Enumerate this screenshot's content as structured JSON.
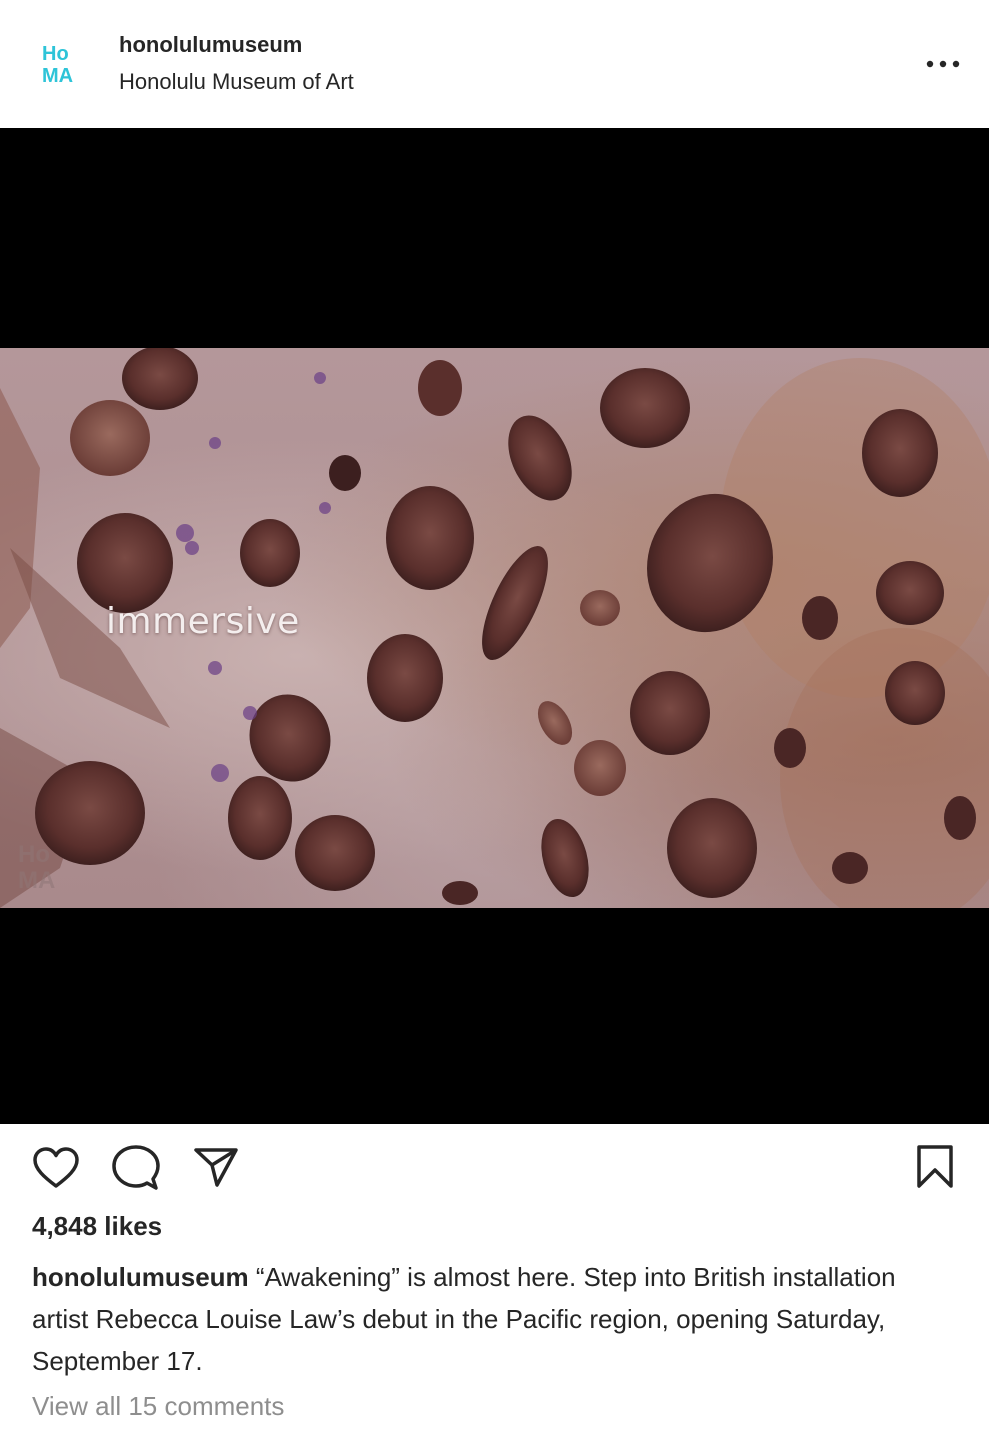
{
  "header": {
    "avatar_text": "HoMA",
    "username": "honolulumuseum",
    "location": "Honolulu Museum of Art",
    "more_icon": "more-horizontal-icon"
  },
  "media": {
    "overlay_text": "immersive",
    "watermark_text": "HoMA"
  },
  "actions": {
    "like_icon": "heart-icon",
    "comment_icon": "comment-icon",
    "share_icon": "paper-plane-icon",
    "save_icon": "bookmark-icon"
  },
  "likes_text": "4,848 likes",
  "caption": {
    "username": "honolulumuseum",
    "text": "“Awakening” is almost here. Step into British installation artist Rebecca Louise Law’s debut in the Pacific region, opening Saturday, September 17."
  },
  "view_comments": "View all 15 comments",
  "colors": {
    "text": "#262626",
    "muted": "#8e8e8e",
    "brand_teal": "#2ec4d8",
    "media_bg": "#000000"
  }
}
